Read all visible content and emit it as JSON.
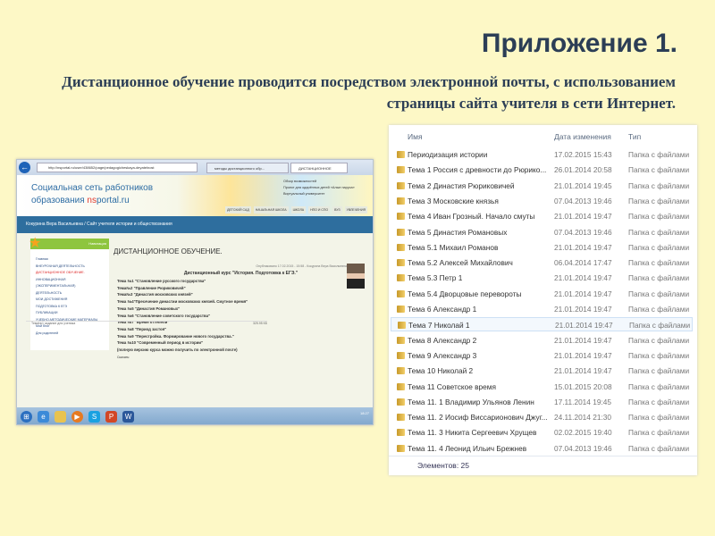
{
  "slide": {
    "title": "Приложение 1.",
    "subtitle": "Дистанционное обучение проводится посредством электронной почты, с использованием страницы сайта учителя в сети Интернет."
  },
  "browser": {
    "url": "http://nsportal.ru/user/438652/page/pedagogicheskaya-deyatelnost",
    "tabs": [
      "методы дистанционного обр...",
      "ДИСТАНЦИОННОЕ ОБУЧЕ..."
    ],
    "logo_line1": "Социальная сеть работников",
    "logo_line2_prefix": "образования ",
    "logo_brand_ns": "ns",
    "logo_brand_rest": "portal.ru",
    "banner_links": [
      "Обзор возможностей",
      "Проект для одарённых детей «Алые паруса»",
      "Виртуальный университет"
    ],
    "menu": [
      "ДЕТСКИЙ САД",
      "НАЧАЛЬНАЯ ШКОЛА",
      "ШКОЛА",
      "НПО И СПО",
      "ВУЗ",
      "УВЛЕЧЕНИЯ"
    ],
    "site_title": "Кокурина Вера Васильевна / Сайт учителя истории и обществознания",
    "nav_title": "Навигация",
    "nav": [
      "Главная",
      "ВНЕУРОЧНАЯ ДЕЯТЕЛЬНОСТЬ",
      "ДИСТАНЦИОННОЕ ОБУЧЕНИЕ.",
      "ИННОВАЦИОННАЯ",
      "(ЭКСПЕРИМЕНТАЛЬНАЯ)",
      "ДЕЯТЕЛЬНОСТЬ",
      "МОИ ДОСТИЖЕНИЯ",
      "ПОДГОТОВКА К ЕГЭ",
      "ПУБЛИКАЦИИ",
      "УЧЕБНО-МЕТОДИЧЕСКИЕ МАТЕРИАЛЫ",
      "Мой блог",
      "Для родителей"
    ],
    "page_heading": "ДИСТАНЦИОННОЕ ОБУЧЕНИЕ.",
    "published": "Опубликовано 17.02.2015 - 15:58 - Кокурина Вера Васильевна",
    "course": "Дистанционный курс  \"История. Подготовка к ЕГЭ.\"",
    "topics": [
      "Тема №1 \"Становление русского государства\"",
      "Тема№2 \"Правление Рюриковичей\"",
      "Тема№3 \"Династия московских князей\"",
      "Тема №4\"Пресечение династии московских князей. Смутное время\"",
      "Тема №5 \"Династия Романовых\"",
      "Тема №6 \"Становление советского государства\"",
      "Тема №7 \"Время оттепели\"",
      "Тема №8  \"Период застоя\"",
      "Тема №9 \"Перестройка. Формирование нового государства.\"",
      "Тема №10 \"Современный период в истории\"",
      "(полную версию курса можно получить по электронной почте)"
    ],
    "download_label": "Скачать:",
    "file": "Тема№1 задание для ученика",
    "file_size": "325.95 КБ",
    "clock": "18:27"
  },
  "explorer": {
    "columns": [
      "Имя",
      "Дата изменения",
      "Тип"
    ],
    "rows": [
      [
        "Периодизация истории",
        "17.02.2015 15:43",
        "Папка с файлами"
      ],
      [
        "Тема 1  Россия с древности до Рюрико...",
        "26.01.2014 20:58",
        "Папка с файлами"
      ],
      [
        "Тема 2 Династия Рюриковичей",
        "21.01.2014 19:45",
        "Папка с файлами"
      ],
      [
        "Тема 3 Московские князья",
        "07.04.2013 19:46",
        "Папка с файлами"
      ],
      [
        "Тема 4  Иван Грозный. Начало смуты",
        "21.01.2014 19:47",
        "Папка с файлами"
      ],
      [
        "Тема 5 Династия Романовых",
        "07.04.2013 19:46",
        "Папка с файлами"
      ],
      [
        "Тема 5.1 Михаил Романов",
        "21.01.2014 19:47",
        "Папка с файлами"
      ],
      [
        "Тема 5.2 Алексей Михайлович",
        "06.04.2014 17:47",
        "Папка с файлами"
      ],
      [
        "Тема 5.3  Петр 1",
        "21.01.2014 19:47",
        "Папка с файлами"
      ],
      [
        "Тема 5.4 Дворцовые перевороты",
        "21.01.2014 19:47",
        "Папка с файлами"
      ],
      [
        "Тема 6  Александр 1",
        "21.01.2014 19:47",
        "Папка с файлами"
      ],
      [
        "Тема 7  Николай 1",
        "21.01.2014 19:47",
        "Папка с файлами"
      ],
      [
        "Тема 8  Александр 2",
        "21.01.2014 19:47",
        "Папка с файлами"
      ],
      [
        "Тема 9  Александр 3",
        "21.01.2014 19:47",
        "Папка с файлами"
      ],
      [
        "Тема 10  Николай 2",
        "21.01.2014 19:47",
        "Папка с файлами"
      ],
      [
        "Тема 11 Советское время",
        "15.01.2015 20:08",
        "Папка с файлами"
      ],
      [
        "Тема 11. 1 Владимир Ульянов Ленин",
        "17.11.2014 19:45",
        "Папка с файлами"
      ],
      [
        "Тема 11. 2 Иосиф Виссарионович Джуг...",
        "24.11.2014 21:30",
        "Папка с файлами"
      ],
      [
        "Тема 11. 3 Никита Сергеевич Хрущев",
        "02.02.2015 19:40",
        "Папка с файлами"
      ],
      [
        "Тема 11. 4 Леонид Ильич Брежнев",
        "07.04.2013 19:46",
        "Папка с файлами"
      ]
    ],
    "selected_index": 11,
    "footer": "Элементов: 25"
  }
}
